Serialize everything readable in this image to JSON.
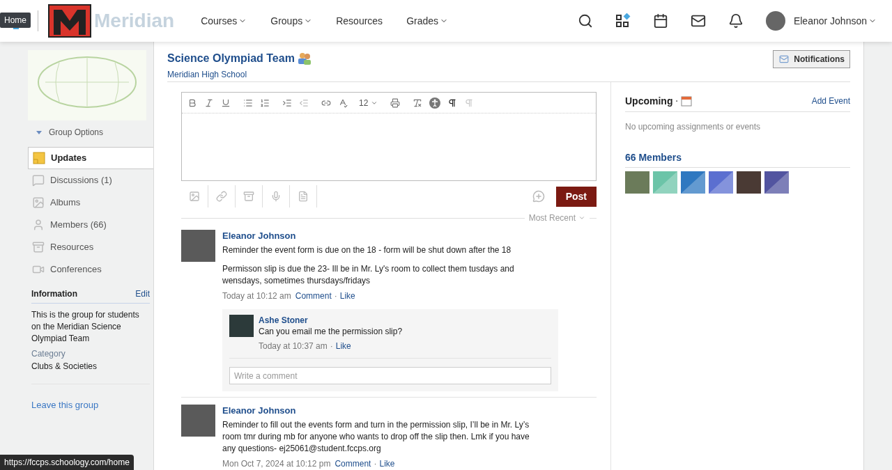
{
  "header": {
    "brand": "Meridian",
    "tooltip": "Home",
    "nav": [
      {
        "label": "Courses",
        "dropdown": true
      },
      {
        "label": "Groups",
        "dropdown": true
      },
      {
        "label": "Resources",
        "dropdown": false
      },
      {
        "label": "Grades",
        "dropdown": true
      }
    ],
    "user": "Eleanor Johnson"
  },
  "sidebar": {
    "group_options": "Group Options",
    "items": [
      {
        "label": "Updates",
        "selected": true,
        "kind": "updates"
      },
      {
        "label": "Discussions (1)",
        "selected": false,
        "kind": "discussions"
      },
      {
        "label": "Albums",
        "selected": false,
        "kind": "albums"
      },
      {
        "label": "Members (66)",
        "selected": false,
        "kind": "members"
      },
      {
        "label": "Resources",
        "selected": false,
        "kind": "resources"
      },
      {
        "label": "Conferences",
        "selected": false,
        "kind": "conferences"
      }
    ],
    "information": {
      "title": "Information",
      "edit": "Edit",
      "description": "This is the group for students on the Meridian Science Olympiad Team",
      "category_label": "Category",
      "category": "Clubs & Societies"
    },
    "leave": "Leave this group"
  },
  "group": {
    "title": "Science Olympiad Team",
    "school": "Meridian High School",
    "notifications": "Notifications"
  },
  "editor": {
    "font_size": "12",
    "post": "Post",
    "sort": "Most Recent"
  },
  "posts": [
    {
      "author": "Eleanor Johnson",
      "paragraphs": [
        "Reminder the event form is due on the 18 - form will be shut down after the 18",
        "Permisson slip is due the 23- Ill be in Mr. Ly's room to collect them tusdays and wensdays, sometimes thursdays/fridays"
      ],
      "time": "Today at 10:12 am",
      "comment": "Comment",
      "separator": "·",
      "like": "Like",
      "comments": [
        {
          "author": "Ashe Stoner",
          "text": "Can you email me the permission slip?",
          "time": "Today at 10:37 am",
          "separator": "·",
          "like": "Like"
        }
      ],
      "comment_placeholder": "Write a comment"
    },
    {
      "author": "Eleanor Johnson",
      "paragraphs": [
        "Reminder to fill out the events form and turn in the permission slip, I’ll be in Mr. Ly’s room tmr during mb for anyone who wants to drop off the slip then. Lmk if you have any questions- ej25061@student.fccps.org"
      ],
      "time": "Mon Oct 7, 2024 at 10:12 pm",
      "comment": "Comment",
      "separator": "·",
      "like": "Like"
    }
  ],
  "upcoming": {
    "title": "Upcoming",
    "separator": "·",
    "add_event": "Add Event",
    "empty": "No upcoming assignments or events"
  },
  "members": {
    "title": "66 Members",
    "avatars": [
      {
        "kind": "photo",
        "color": "#6b7b5a"
      },
      {
        "kind": "pattern",
        "color": "#6cc4a8"
      },
      {
        "kind": "pattern",
        "color": "#2f78c0"
      },
      {
        "kind": "pattern",
        "color": "#5b6fd0"
      },
      {
        "kind": "photo",
        "color": "#4a3a34"
      },
      {
        "kind": "pattern",
        "color": "#5254a0"
      }
    ]
  },
  "status_bar": "https://fccps.schoology.com/home"
}
